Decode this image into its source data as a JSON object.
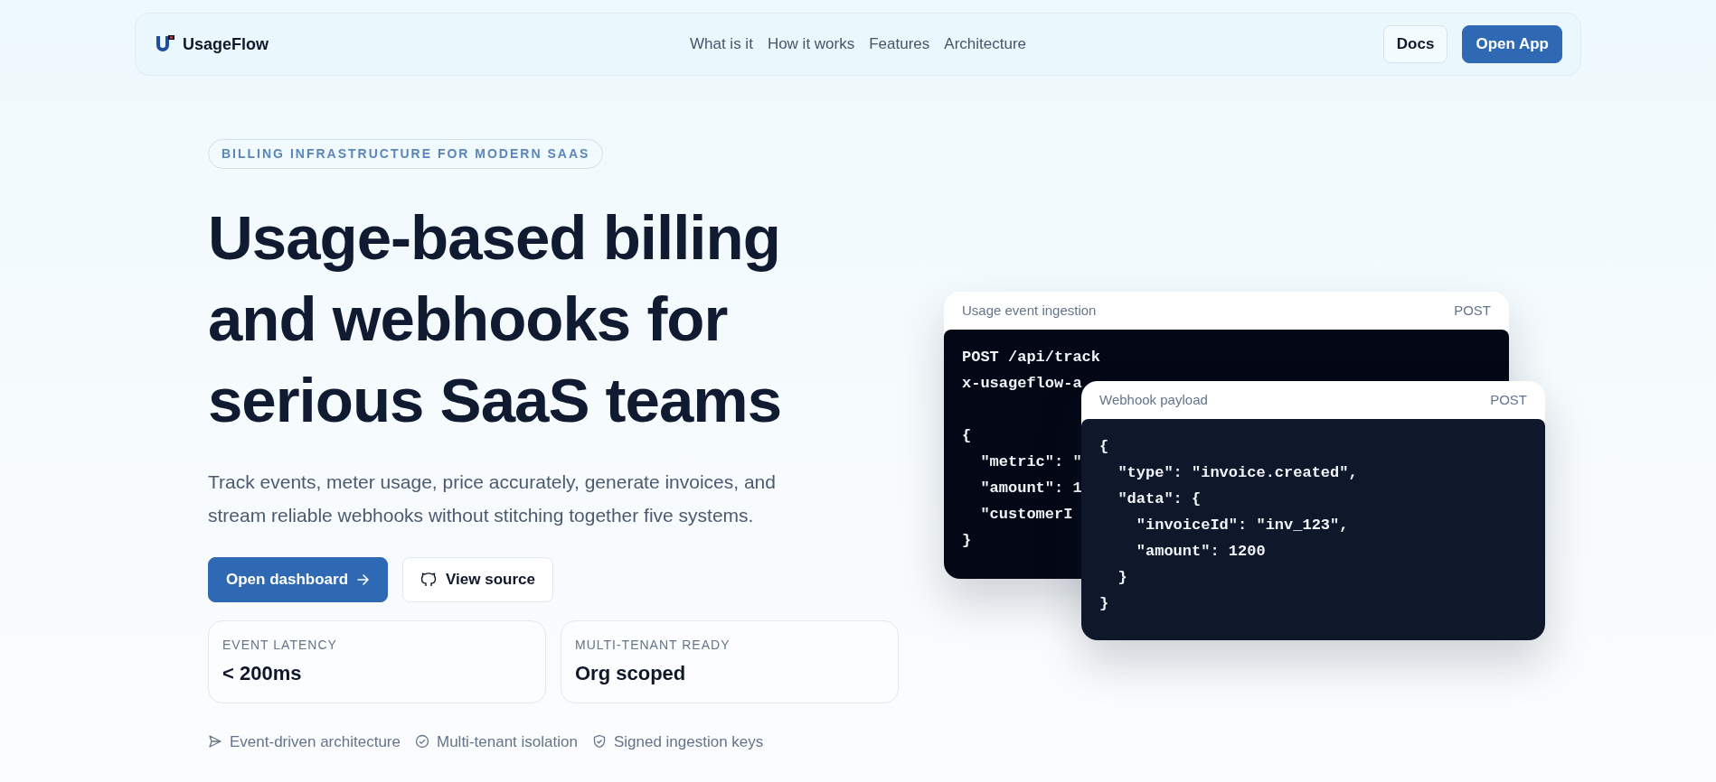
{
  "nav": {
    "brand": "UsageFlow",
    "links": [
      "What is it",
      "How it works",
      "Features",
      "Architecture"
    ],
    "buttons": [
      {
        "label": "Docs",
        "kind": "outline"
      },
      {
        "label": "Open App",
        "kind": "primary"
      }
    ]
  },
  "hero": {
    "eyebrow": "BILLING INFRASTRUCTURE FOR MODERN SAAS",
    "headline": "Usage-based billing and webhooks for serious SaaS teams",
    "lead": "Track events, meter usage, price accurately, generate invoices, and stream reliable webhooks without stitching together five systems.",
    "actions": [
      {
        "label": "Open dashboard",
        "kind": "primary"
      },
      {
        "label": "View source",
        "kind": "outline"
      }
    ],
    "stats": [
      {
        "label": "EVENT LATENCY",
        "value": "< 200ms"
      },
      {
        "label": "MULTI-TENANT READY",
        "value": "Org scoped"
      }
    ],
    "features": [
      {
        "label": "Event-driven architecture"
      },
      {
        "label": "Multi-tenant isolation"
      },
      {
        "label": "Signed ingestion keys"
      }
    ]
  },
  "code_cards": [
    {
      "title": "Usage event ingestion",
      "method": "POST",
      "request_lines": [
        "POST /api/track",
        "x-usageflow-a"
      ],
      "lines": [
        "{",
        "  \"metric\": \"",
        "  \"amount\": 1",
        "  \"customerI",
        "}"
      ]
    },
    {
      "title": "Webhook payload",
      "method": "POST",
      "lines": [
        "{",
        "  \"type\": \"invoice.created\",",
        "  \"data\": {",
        "    \"invoiceId\": \"inv_123\",",
        "    \"amount\": 1200",
        "  }",
        "}"
      ]
    }
  ]
}
